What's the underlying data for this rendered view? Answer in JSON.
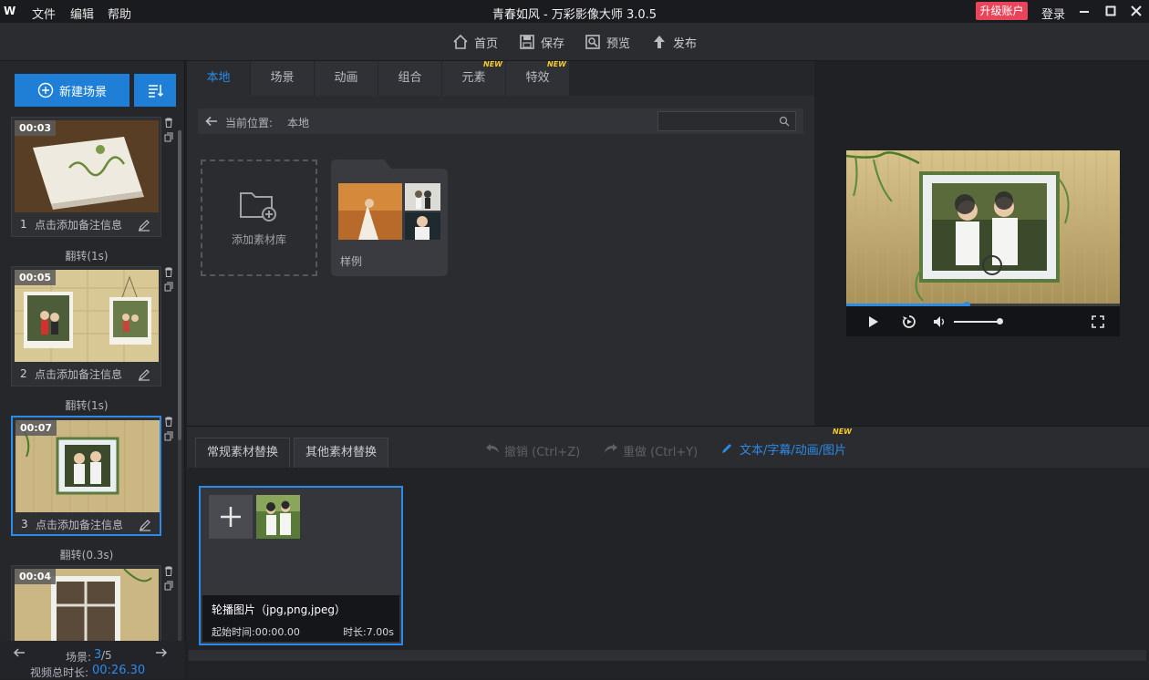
{
  "titlebar": {
    "logo": "W",
    "menu": [
      "文件",
      "编辑",
      "帮助"
    ],
    "title": "青春如风 - 万彩影像大师 3.0.5",
    "upgrade": "升级账户",
    "login": "登录"
  },
  "toolbar": {
    "home": "首页",
    "save": "保存",
    "preview": "预览",
    "publish": "发布"
  },
  "left": {
    "new_scene": "新建场景",
    "scenes": [
      {
        "duration": "00:03",
        "index": "1",
        "note": "点击添加备注信息"
      },
      {
        "duration": "00:05",
        "index": "2",
        "note": "点击添加备注信息"
      },
      {
        "duration": "00:07",
        "index": "3",
        "note": "点击添加备注信息"
      },
      {
        "duration": "00:04"
      }
    ],
    "transitions": [
      "翻转(1s)",
      "翻转(1s)",
      "翻转(0.3s)"
    ],
    "footer": {
      "scene_label": "场景:",
      "scene_current": "3",
      "scene_total": "/5",
      "total_label": "视频总时长:",
      "total_time": "00:26.30"
    }
  },
  "center": {
    "tabs": [
      "本地",
      "场景",
      "动画",
      "组合",
      "元素",
      "特效"
    ],
    "new_tag": "NEW",
    "path_label": "当前位置:",
    "path_value": "本地",
    "add_library": "添加素材库",
    "folder_label": "样例"
  },
  "bottom": {
    "tabs": [
      "常规素材替换",
      "其他素材替换"
    ],
    "undo": "撤销 (Ctrl+Z)",
    "redo": "重做 (Ctrl+Y)",
    "text_edit": "文本/字幕/动画/图片",
    "new_tag": "NEW",
    "card": {
      "title": "轮播图片（jpg,png,jpeg）",
      "start": "起始时间:00:00.00",
      "length": "时长:7.00s"
    }
  },
  "preview": {
    "progress": 0.44
  },
  "colors": {
    "accent": "#2c8be8",
    "upgrade": "#e8455a",
    "new_tag": "#f3c92b"
  }
}
